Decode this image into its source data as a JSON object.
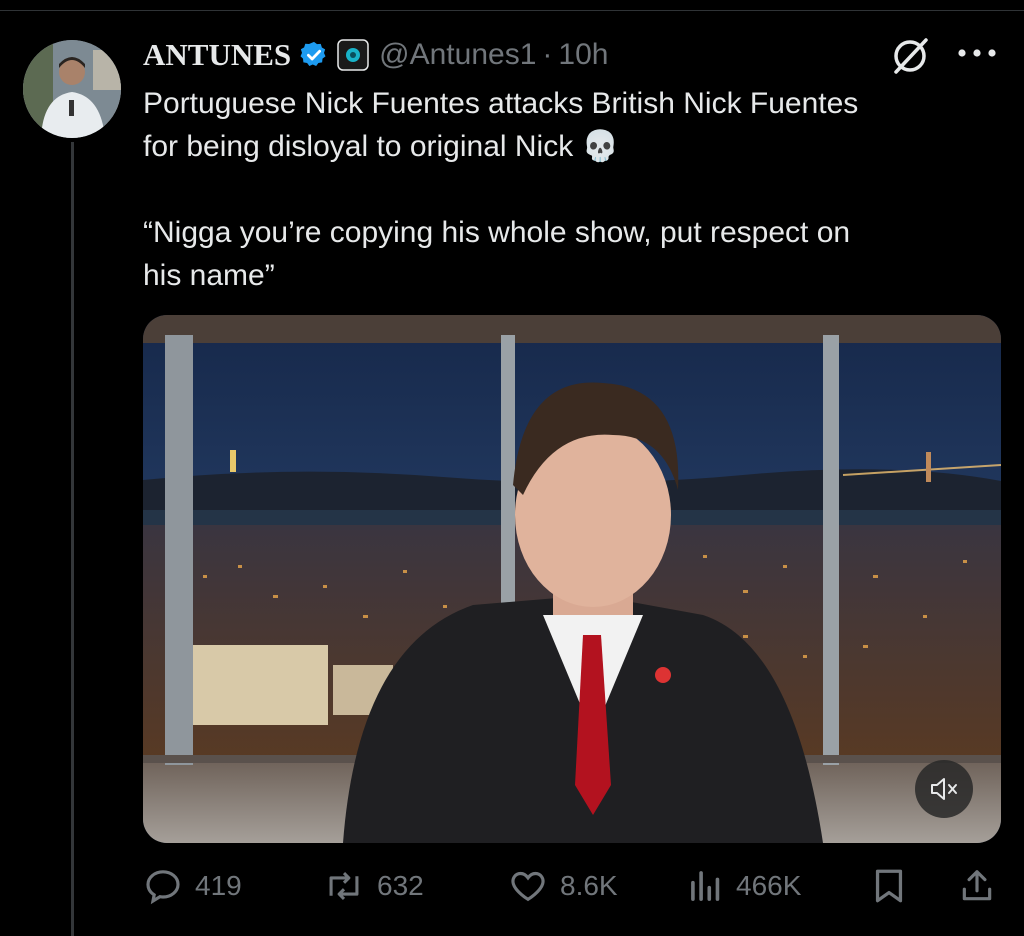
{
  "author": {
    "name": "ANTUNES",
    "handle": "@Antunes1",
    "separator": "·",
    "time": "10h"
  },
  "tweet": {
    "line1": "Portuguese Nick Fuentes attacks British Nick Fuentes",
    "line2": "for being disloyal to original Nick",
    "emoji": "💀",
    "quote_line1": "“Nigga you’re copying his whole show, put respect on",
    "quote_line2": "his name”"
  },
  "media": {
    "muted": true
  },
  "stats": {
    "replies": "419",
    "reposts": "632",
    "likes": "8.6K",
    "views": "466K"
  },
  "icons": {
    "verified": "verified-badge-icon",
    "affiliate": "affiliate-badge-icon",
    "grok": "grok-icon",
    "more": "more-icon",
    "reply": "reply-icon",
    "repost": "repost-icon",
    "like": "like-icon",
    "views": "views-icon",
    "bookmark": "bookmark-icon",
    "share": "share-icon",
    "mute": "mute-icon"
  },
  "colors": {
    "background": "#000000",
    "text": "#e7e9ea",
    "secondary": "#71767b",
    "verified": "#1d9bf0"
  }
}
